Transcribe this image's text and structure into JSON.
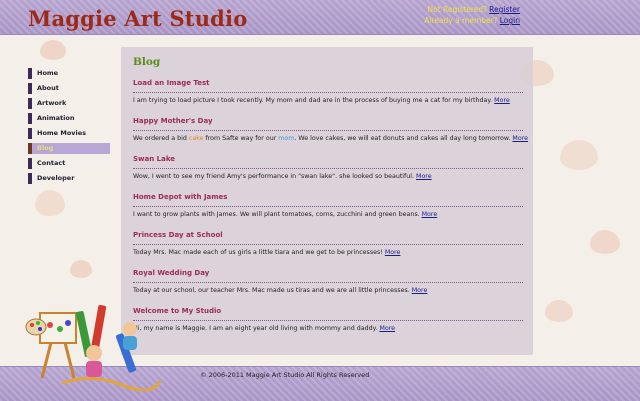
{
  "header": {
    "site_title": "Maggie Art Studio",
    "not_registered": "Not Registered?",
    "register_link": "Register",
    "already_member": "Already a member?",
    "login_link": "Login"
  },
  "nav": {
    "items": [
      {
        "label": "Home"
      },
      {
        "label": "About"
      },
      {
        "label": "Artwork"
      },
      {
        "label": "Animation"
      },
      {
        "label": "Home Movies"
      },
      {
        "label": "Blog"
      },
      {
        "label": "Contact"
      },
      {
        "label": "Developer"
      }
    ],
    "active": "Blog"
  },
  "main": {
    "heading": "Blog",
    "more_label": "More",
    "posts": [
      {
        "title": "Load an Image Test",
        "body": "I am trying to load picture I took recently. My mom and dad are in the process of buying me a cat for my birthday."
      },
      {
        "title": "Happy Mother's Day",
        "body_pre": "We ordered a bid ",
        "body_cake": "cake",
        "body_mid": " from Safte way for our ",
        "body_mom": "mom",
        "body_post": ". We love cakes, we will eat donuts and cakes all day long tomorrow."
      },
      {
        "title": "Swan Lake",
        "body": "Wow, I went to see my friend Amy's performance in \"swan lake\". she looked so beautiful."
      },
      {
        "title": "Home Depot with James",
        "body": "I want to grow plants with James. We will plant tomatoes, corns, zucchini and green beans."
      },
      {
        "title": "Princess Day at School",
        "body": "Today Mrs. Mac made each of us girls a little tiara and we get to be princesses!"
      },
      {
        "title": "Royal Wedding Day",
        "body": "Today at our school, our teacher Mrs. Mac made us tiras and we are all little princesses."
      },
      {
        "title": "Welcome to My Studio",
        "body": "Hi, my name is Maggie. I am an eight year old living with mommy and daddy."
      }
    ]
  },
  "footer": {
    "copyright": "© 2006-2011 Maggie Art Studio All Rights Reserved"
  },
  "colors": {
    "header_band": "#b09dcb",
    "title": "#9c2a16",
    "blog_heading": "#5c8a1a",
    "post_title": "#9c2a5a",
    "link": "#1b1c8a",
    "active_nav": "#b8a6d6"
  }
}
